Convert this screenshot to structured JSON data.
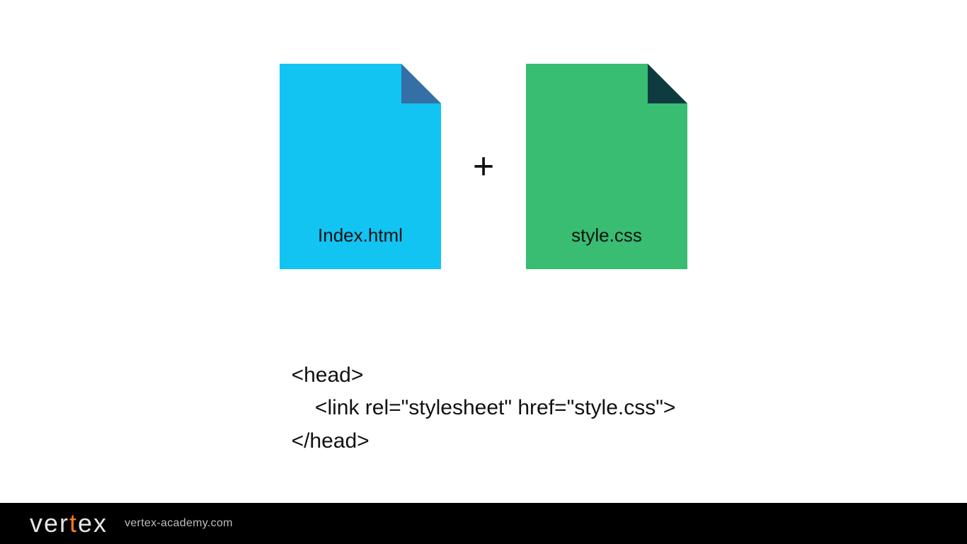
{
  "files": {
    "left_label": "Index.html",
    "right_label": "style.css",
    "plus": "+"
  },
  "code": {
    "line1": "<head>",
    "line2": "    <link rel=\"stylesheet\" href=\"style.css\">",
    "line3": "</head>"
  },
  "footer": {
    "logo_prefix": "ver",
    "logo_t": "t",
    "logo_suffix": "ex",
    "url": "vertex-academy.com"
  },
  "colors": {
    "file_html": "#12c4f2",
    "file_html_fold": "#3470a5",
    "file_css": "#38bd72",
    "file_css_fold": "#0d3b3f",
    "accent": "#ff7a1a"
  }
}
